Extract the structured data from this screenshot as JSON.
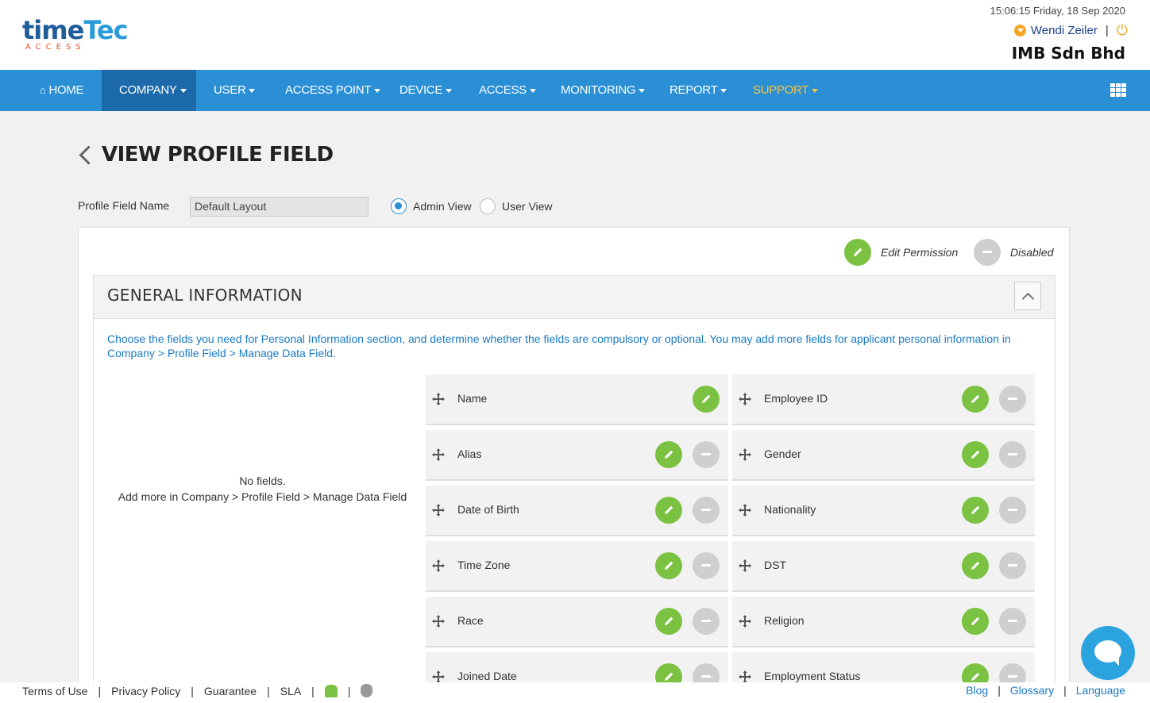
{
  "app": {
    "logo_main": "time",
    "logo_accent": "Tec",
    "logo_sub": "ACCESS",
    "datetime": "15:06:15 Friday, 18 Sep 2020",
    "user_name": "Wendi Zeiler",
    "user_sep": "|",
    "company": "IMB Sdn Bhd"
  },
  "nav": {
    "items": [
      {
        "label": "HOME",
        "icon": "home-icon"
      },
      {
        "label": "COMPANY"
      },
      {
        "label": "USER"
      },
      {
        "label": "ACCESS POINT"
      },
      {
        "label": "DEVICE"
      },
      {
        "label": "ACCESS"
      },
      {
        "label": "MONITORING"
      },
      {
        "label": "REPORT"
      },
      {
        "label": "SUPPORT"
      }
    ],
    "active": "COMPANY",
    "highlight_color": "#f5c342",
    "bar_color": "#2b8fd6"
  },
  "page": {
    "title": "VIEW PROFILE FIELD",
    "profile_field_label": "Profile Field Name",
    "profile_field_value": "Default Layout",
    "radio_admin": "Admin View",
    "radio_user": "User View",
    "selected_view": "Admin View"
  },
  "legend": {
    "edit": "Edit Permission",
    "disabled": "Disabled"
  },
  "section": {
    "title": "GENERAL INFORMATION",
    "description": "Choose the fields you need for Personal Information section, and determine whether the fields are compulsory or optional. You may add more fields for applicant personal information in Company > Profile Field > Manage Data Field.",
    "no_fields_line1": "No fields.",
    "no_fields_line2": "Add more in Company > Profile Field > Manage Data Field",
    "fields": [
      "Name",
      "Employee ID",
      "Alias",
      "Gender",
      "Date of Birth",
      "Nationality",
      "Time Zone",
      "DST",
      "Race",
      "Religion",
      "Joined Date",
      "Employment Status"
    ]
  },
  "footer": {
    "left": [
      "Terms of Use",
      "Privacy Policy",
      "Guarantee",
      "SLA"
    ],
    "right": [
      "Blog",
      "Glossary",
      "Language"
    ],
    "sep": "|"
  },
  "colors": {
    "green": "#7cc242",
    "grey": "#cfcfcf",
    "link": "#1a7ac4"
  }
}
